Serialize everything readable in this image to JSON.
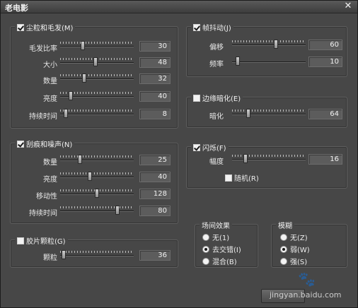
{
  "window": {
    "title": "老电影",
    "close_glyph": "✕"
  },
  "dust": {
    "label": "尘粒和毛发(M)",
    "checked": true,
    "sliders": [
      {
        "label": "毛发比率",
        "value": "30",
        "level": 0.3
      },
      {
        "label": "大小",
        "value": "48",
        "level": 0.48
      },
      {
        "label": "数量",
        "value": "32",
        "level": 0.32
      },
      {
        "label": "亮度",
        "value": "40",
        "level": 0.12
      },
      {
        "label": "持续时间",
        "value": "8",
        "level": 0.05
      }
    ]
  },
  "shake": {
    "label": "帧抖动(J)",
    "checked": true,
    "sliders": [
      {
        "label": "偏移",
        "value": "60",
        "level": 0.6
      },
      {
        "label": "频率",
        "value": "10",
        "level": 0.05
      }
    ]
  },
  "vignette": {
    "label": "边缘暗化(E)",
    "checked": false,
    "sliders": [
      {
        "label": "暗化",
        "value": "64",
        "level": 0.2
      }
    ]
  },
  "scratches": {
    "label": "刮痕和噪声(N)",
    "checked": true,
    "sliders": [
      {
        "label": "数量",
        "value": "25",
        "level": 0.25
      },
      {
        "label": "亮度",
        "value": "40",
        "level": 0.4
      },
      {
        "label": "移动性",
        "value": "128",
        "level": 0.5
      },
      {
        "label": "持续时间",
        "value": "80",
        "level": 0.8
      }
    ]
  },
  "flicker": {
    "label": "闪烁(F)",
    "checked": true,
    "sliders": [
      {
        "label": "幅度",
        "value": "16",
        "level": 0.16
      }
    ],
    "random_label": "随机(R)",
    "random_checked": false
  },
  "grain": {
    "label": "胶片颗粒(G)",
    "checked": false,
    "sliders": [
      {
        "label": "颗粒",
        "value": "36",
        "level": 0.02
      }
    ]
  },
  "transition": {
    "label": "场间效果",
    "options": [
      {
        "label": "无(1)",
        "selected": false
      },
      {
        "label": "去交错(I)",
        "selected": true
      },
      {
        "label": "混合(B)",
        "selected": false
      }
    ]
  },
  "blur": {
    "label": "模糊",
    "options": [
      {
        "label": "无(Z)",
        "selected": false
      },
      {
        "label": "弱(W)",
        "selected": true
      },
      {
        "label": "强(S)",
        "selected": false
      }
    ]
  },
  "watermark": {
    "text": "jingyan.baidu.com",
    "paw_glyph": "🐾"
  }
}
